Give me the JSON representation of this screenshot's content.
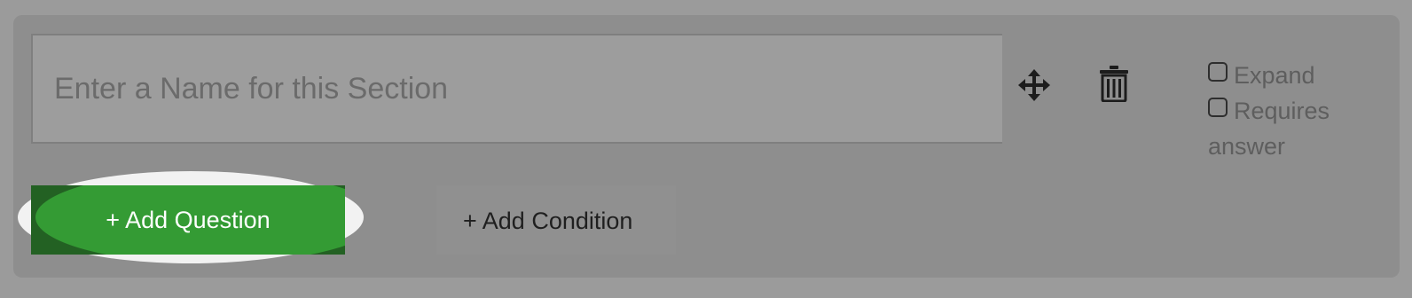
{
  "section": {
    "name_input": {
      "value": "",
      "placeholder": "Enter a Name for this Section"
    },
    "move_icon": "move-arrows-icon",
    "delete_icon": "trash-icon",
    "options": {
      "expand_label": "Expand",
      "expand_checked": false,
      "requires_answer_label": "Requires answer",
      "requires_answer_checked": false
    },
    "actions": {
      "add_question_label": "+ Add Question",
      "add_condition_label": "+ Add Condition"
    }
  },
  "colors": {
    "page_background": "#9b9b9b",
    "card_background": "#8e8e8e",
    "add_question_green": "#349b34",
    "highlight_ring": "#f2f2f2"
  }
}
